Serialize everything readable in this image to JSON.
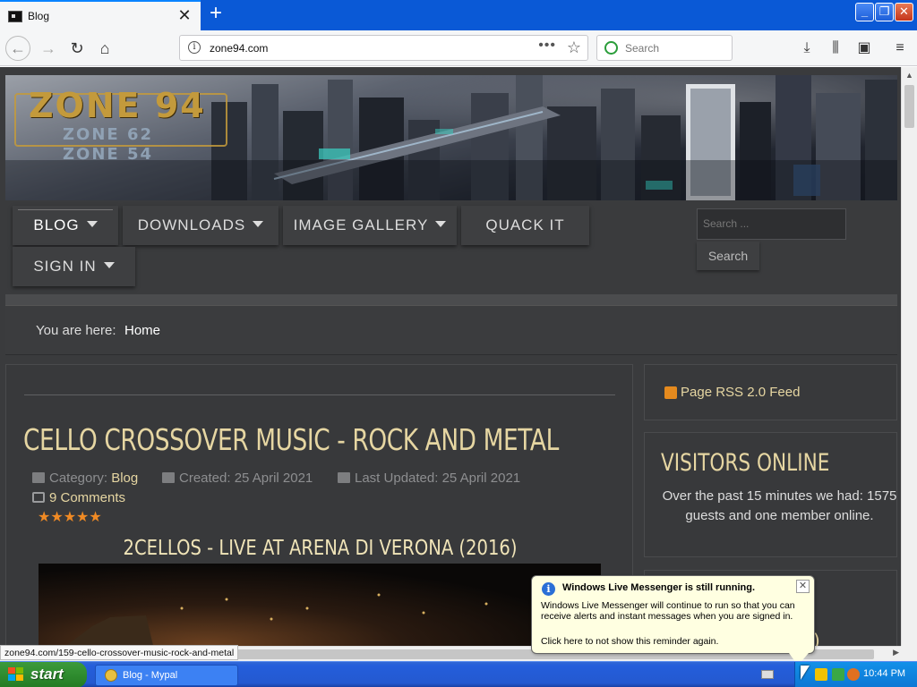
{
  "browser": {
    "tab_title": "Blog",
    "tab_close_glyph": "✕",
    "new_tab_glyph": "+",
    "url": "zone94.com",
    "search_placeholder": "Search",
    "page_actions_glyph": "•••",
    "bookmark_glyph": "☆",
    "icons": [
      "back-arrow-icon",
      "forward-arrow-icon",
      "reload-icon",
      "home-icon",
      "download-icon",
      "library-icon",
      "sidebar-icon",
      "hamburger-menu-icon"
    ]
  },
  "site": {
    "logo": "ZONE 94",
    "logo_sub1": "ZONE 62",
    "logo_sub2": "ZONE 54",
    "menu": {
      "blog": "BLOG",
      "downloads": "DOWNLOADS",
      "gallery": "IMAGE GALLERY",
      "quack": "QUACK IT",
      "signin": "SIGN IN"
    },
    "search": {
      "placeholder": "Search ...",
      "button": "Search"
    },
    "breadcrumb": {
      "label": "You are here:",
      "current": "Home"
    }
  },
  "article": {
    "title": "CELLO CROSSOVER MUSIC - ROCK AND METAL",
    "category_label": "Category:",
    "category": "Blog",
    "created": "Created: 25 April 2021",
    "updated": "Last Updated: 25 April 2021",
    "comments": "9 Comments",
    "rating": 5,
    "rating_stars": "★★★★★",
    "video_title": "2CELLOS - LIVE AT ARENA DI VERONA (2016)"
  },
  "sidebar": {
    "rss": "Page RSS 2.0 Feed",
    "visitors_title": "VISITORS ONLINE",
    "visitors_text": "Over the past 15 minutes we had: 1575 guests and one member online."
  },
  "status_url": "zone94.com/159-cello-crossover-music-rock-and-metal",
  "balloon": {
    "title": "Windows Live Messenger is still running.",
    "body": "Windows Live Messenger will continue to run so that you can receive alerts and instant messages when you are signed in.",
    "link": "Click here to not show this reminder again."
  },
  "taskbar": {
    "start": "start",
    "task": "Blog - Mypal",
    "clock": "10:44 PM"
  },
  "colors": {
    "accent_text": "#e6d6a2",
    "page_bg": "#3a3b3d",
    "rating": "#f08a24",
    "xp_taskbar": "#245edb",
    "xp_start": "#2f8c2f"
  }
}
